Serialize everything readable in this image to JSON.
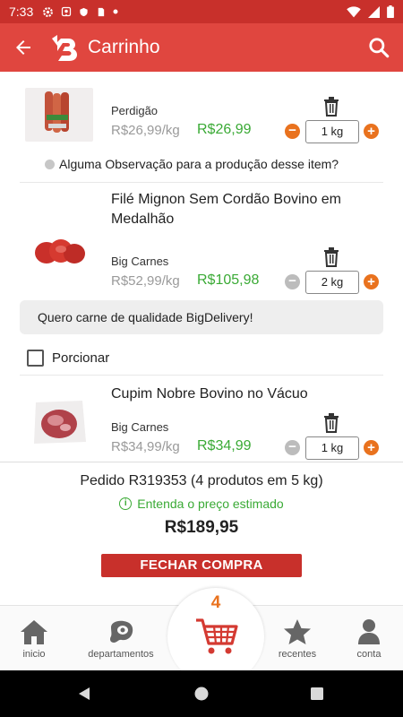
{
  "status_bar": {
    "time": "7:33"
  },
  "app_bar": {
    "title": "Carrinho"
  },
  "items": [
    {
      "name": "",
      "brand": "Perdigão",
      "old_price": "R$26,99/kg",
      "price": "R$26,99",
      "quantity": "1 kg",
      "observation": "Alguma Observação para a produção desse item?"
    },
    {
      "name_line1": "Filé Mignon Sem Cordão Bovino em",
      "name_line2": "Medalhão",
      "brand": "Big Carnes",
      "old_price": "R$52,99/kg",
      "price": "R$105,98",
      "quantity": "2 kg",
      "note": "Quero carne de qualidade BigDelivery!",
      "portion_label": "Porcionar"
    },
    {
      "name": "Cupim Nobre Bovino no Vácuo",
      "brand": "Big Carnes",
      "old_price": "R$34,99/kg",
      "price": "R$34,99",
      "quantity": "1 kg"
    }
  ],
  "summary": {
    "order": "Pedido R319353 (4 produtos em 5 kg)",
    "hint": "Entenda o preço estimado",
    "total": "R$189,95",
    "checkout_label": "FECHAR COMPRA"
  },
  "nav": {
    "home": "inicio",
    "departments": "departamentos",
    "cart_count": "4",
    "recent": "recentes",
    "account": "conta"
  },
  "colors": {
    "header": "#e0463f",
    "status": "#c8302b",
    "price_green": "#3aaa35",
    "accent_orange": "#e9721e"
  }
}
